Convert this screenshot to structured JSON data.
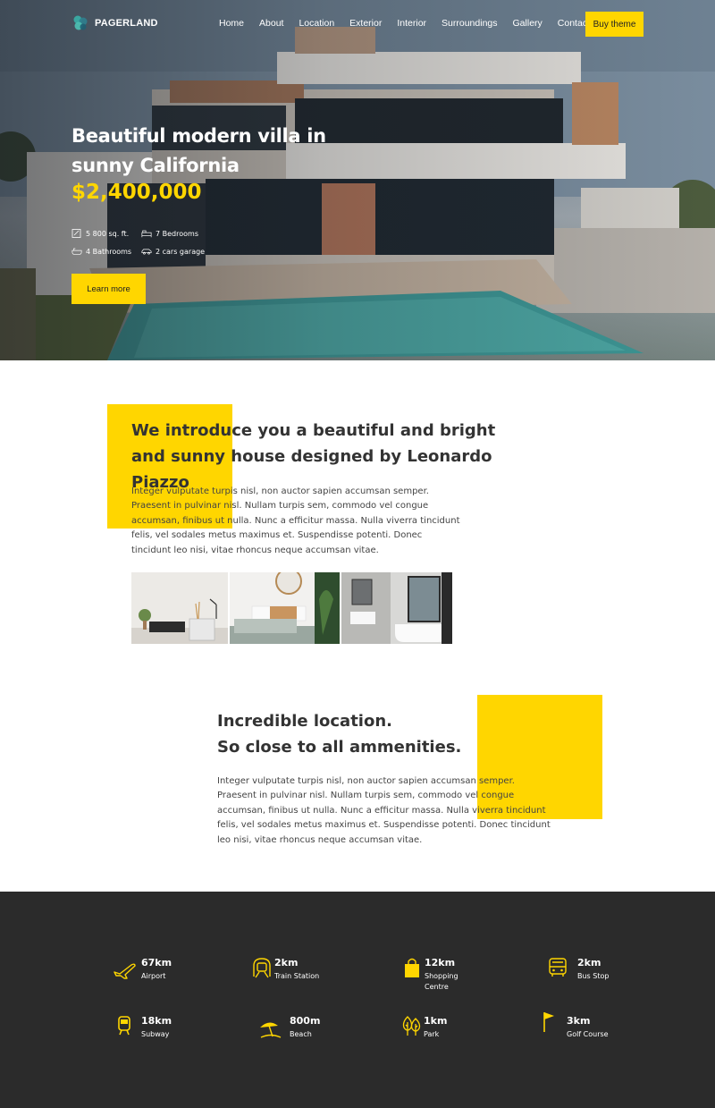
{
  "brand": {
    "name": "PAGERLAND",
    "accent": "#ffd600",
    "dark": "#2b2b2b"
  },
  "nav": {
    "items": [
      "Home",
      "About",
      "Location",
      "Exterior",
      "Interior",
      "Surroundings",
      "Gallery",
      "Contact"
    ],
    "buy_label": "Buy theme"
  },
  "hero": {
    "title": "Beautiful modern villa in sunny California",
    "price": "$2,400,000",
    "specs": [
      {
        "icon": "area-icon",
        "label": "5 800 sq. ft."
      },
      {
        "icon": "bed-icon",
        "label": "7 Bedrooms"
      },
      {
        "icon": "bath-icon",
        "label": "4 Bathrooms"
      },
      {
        "icon": "car-icon",
        "label": "2 cars garage"
      }
    ],
    "cta_label": "Learn more"
  },
  "intro": {
    "title": "We introduce you a beautiful and bright and sunny house designed by Leonardo Piazzo",
    "text": "Integer vulputate turpis nisl, non auctor sapien accumsan semper. Praesent in pulvinar nisl. Nullam turpis sem, commodo vel congue accumsan, finibus ut nulla. Nunc a efficitur massa. Nulla viverra tincidunt felis, vel sodales metus maximus et. Suspendisse potenti. Donec tincidunt leo nisi, vitae rhoncus neque accumsan vitae."
  },
  "location": {
    "title_line1": "Incredible location.",
    "title_line2": "So close to all ammenities.",
    "text": "Integer vulputate turpis nisl, non auctor sapien accumsan semper. Praesent in pulvinar nisl. Nullam turpis sem, commodo vel congue accumsan, finibus ut nulla. Nunc a efficitur massa. Nulla viverra tincidunt felis, vel sodales metus maximus et. Suspendisse potenti. Donec tincidunt leo nisi, vitae rhoncus neque accumsan vitae."
  },
  "amenities": [
    {
      "icon": "airplane-icon",
      "distance": "67km",
      "name": "Airport"
    },
    {
      "icon": "train-icon",
      "distance": "2km",
      "name": "Train Station"
    },
    {
      "icon": "shopping-bag-icon",
      "distance": "12km",
      "name": "Shopping Centre"
    },
    {
      "icon": "bus-icon",
      "distance": "2km",
      "name": "Bus Stop"
    },
    {
      "icon": "subway-icon",
      "distance": "18km",
      "name": "Subway"
    },
    {
      "icon": "beach-icon",
      "distance": "800m",
      "name": "Beach"
    },
    {
      "icon": "tree-icon",
      "distance": "1km",
      "name": "Park"
    },
    {
      "icon": "flag-icon",
      "distance": "3km",
      "name": "Golf Course"
    }
  ]
}
